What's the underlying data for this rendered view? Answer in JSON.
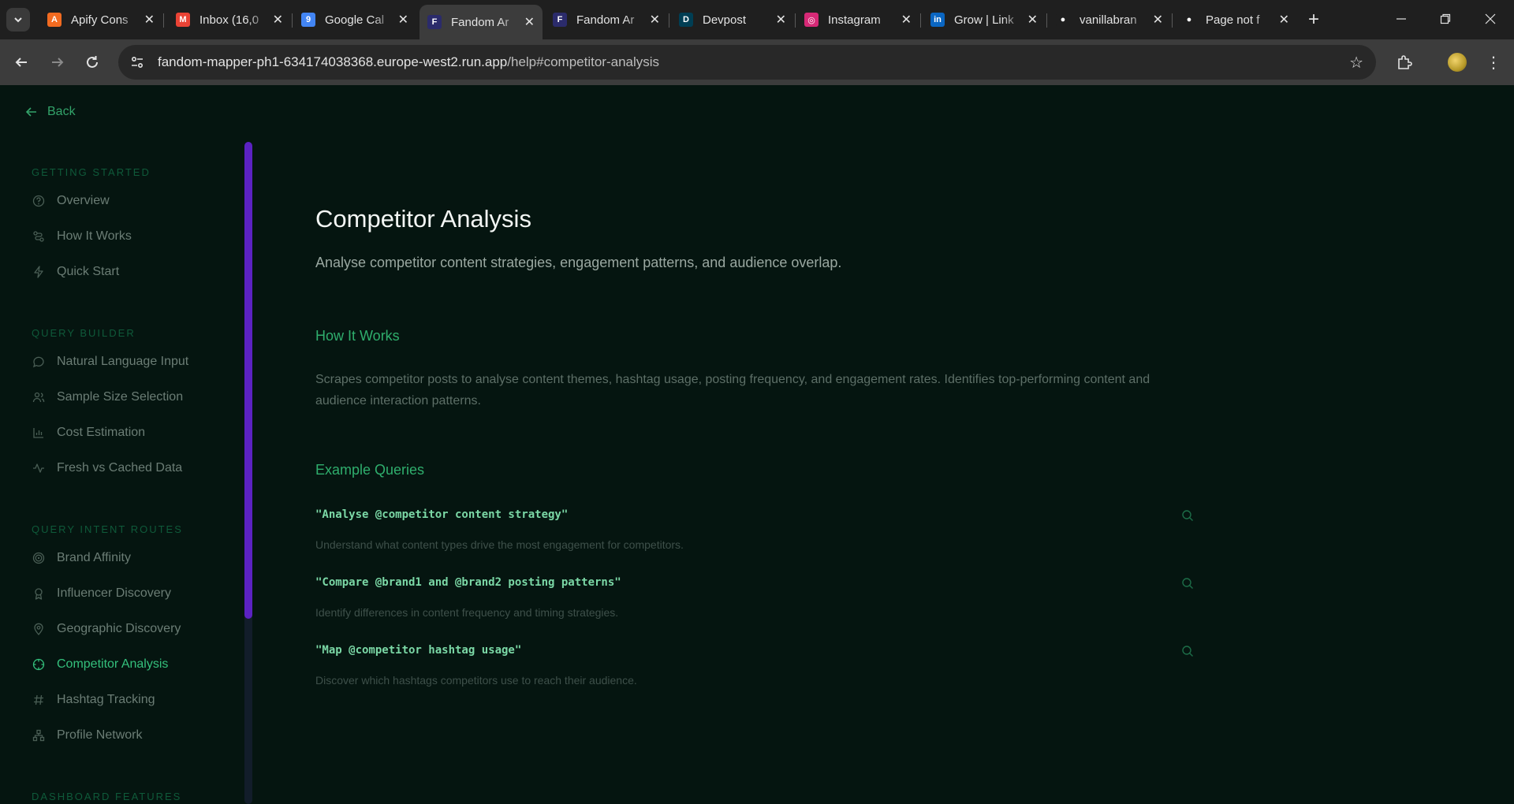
{
  "browser": {
    "tabs": [
      {
        "title": "Apify Cons",
        "favicon": "apify-icon",
        "color": "#f26b21",
        "letter": "A"
      },
      {
        "title": "Inbox (16,0",
        "favicon": "gmail-icon",
        "color": "#ea4335",
        "letter": "M"
      },
      {
        "title": "Google Cal",
        "favicon": "google-calendar-icon",
        "color": "#4285f4",
        "letter": "9"
      },
      {
        "title": "Fandom Ar",
        "favicon": "fandom-icon",
        "color": "#2b2b6b",
        "letter": "F"
      },
      {
        "title": "Fandom Ar",
        "favicon": "fandom-icon",
        "color": "#2b2b6b",
        "letter": "F"
      },
      {
        "title": "Devpost",
        "favicon": "devpost-icon",
        "color": "#003e54",
        "letter": "D"
      },
      {
        "title": "Instagram",
        "favicon": "instagram-icon",
        "color": "#d62976",
        "letter": "◎"
      },
      {
        "title": "Grow | Link",
        "favicon": "linkedin-icon",
        "color": "#0a66c2",
        "letter": "in"
      },
      {
        "title": "vanillabran",
        "favicon": "github-icon",
        "color": "#1f1f1f",
        "letter": "●"
      },
      {
        "title": "Page not f",
        "favicon": "github-icon",
        "color": "#1f1f1f",
        "letter": "●"
      }
    ],
    "active_tab": 3,
    "url_host": "fandom-mapper-ph1-634174038368.europe-west2.run.app",
    "url_path": "/help#competitor-analysis"
  },
  "back_label": "Back",
  "sidebar": {
    "sections": [
      {
        "title": "GETTING STARTED",
        "items": [
          {
            "label": "Overview",
            "icon": "help-circle-icon"
          },
          {
            "label": "How It Works",
            "icon": "workflow-icon"
          },
          {
            "label": "Quick Start",
            "icon": "lightning-icon"
          }
        ]
      },
      {
        "title": "QUERY BUILDER",
        "items": [
          {
            "label": "Natural Language Input",
            "icon": "chat-bubble-icon"
          },
          {
            "label": "Sample Size Selection",
            "icon": "users-icon"
          },
          {
            "label": "Cost Estimation",
            "icon": "bar-chart-icon"
          },
          {
            "label": "Fresh vs Cached Data",
            "icon": "activity-icon"
          }
        ]
      },
      {
        "title": "QUERY INTENT ROUTES",
        "items": [
          {
            "label": "Brand Affinity",
            "icon": "target-icon"
          },
          {
            "label": "Influencer Discovery",
            "icon": "award-icon"
          },
          {
            "label": "Geographic Discovery",
            "icon": "map-pin-icon"
          },
          {
            "label": "Competitor Analysis",
            "icon": "crosshair-icon",
            "active": true
          },
          {
            "label": "Hashtag Tracking",
            "icon": "hash-icon"
          },
          {
            "label": "Profile Network",
            "icon": "network-icon"
          }
        ]
      },
      {
        "title": "DASHBOARD FEATURES",
        "items": []
      }
    ]
  },
  "content": {
    "title": "Competitor Analysis",
    "subtitle": "Analyse competitor content strategies, engagement patterns, and audience overlap.",
    "how_title": "How It Works",
    "how_text": "Scrapes competitor posts to analyse content themes, hashtag usage, posting frequency, and engagement rates. Identifies top-performing content and audience interaction patterns.",
    "examples_title": "Example Queries",
    "examples": [
      {
        "query": "\"Analyse @competitor content strategy\"",
        "desc": "Understand what content types drive the most engagement for competitors."
      },
      {
        "query": "\"Compare @brand1 and @brand2 posting patterns\"",
        "desc": "Identify differences in content frequency and timing strategies."
      },
      {
        "query": "\"Map @competitor hashtag usage\"",
        "desc": "Discover which hashtags competitors use to reach their audience."
      }
    ]
  }
}
